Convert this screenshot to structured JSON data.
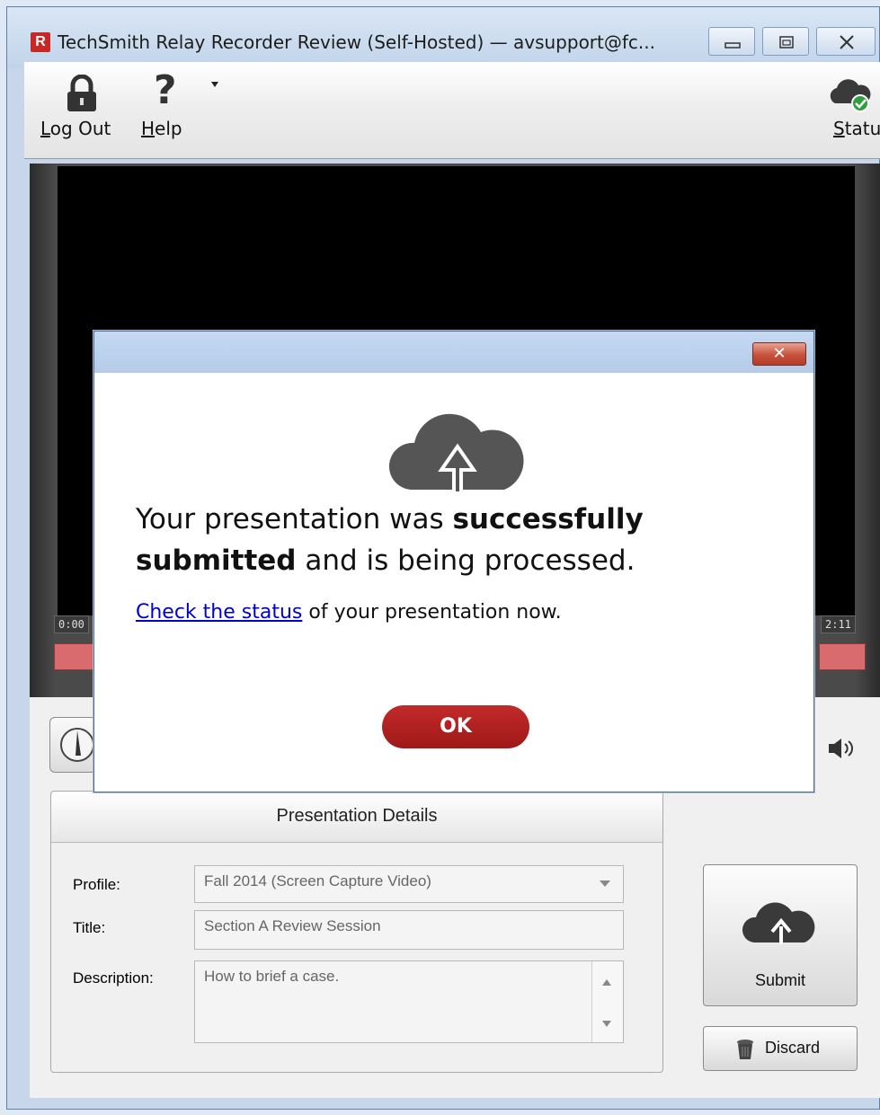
{
  "window": {
    "title": "TechSmith Relay Recorder Review (Self-Hosted) — avsupport@fc...",
    "app_icon_letter": "R"
  },
  "toolbar": {
    "logout_label_underlined": "L",
    "logout_label_rest": "og Out",
    "help_label_underlined": "H",
    "help_label_rest": "elp",
    "help_glyph": "?",
    "status_label_underlined": "S",
    "status_label_rest": "tatus"
  },
  "player": {
    "time_start": "0:00",
    "time_end": "2:11"
  },
  "dialog": {
    "message_part1": "Your presentation was ",
    "message_bold": "successfully submitted",
    "message_part2": " and is being processed.",
    "link_text": "Check the status",
    "link_rest": " of your presentation now.",
    "ok_label": "OK",
    "close_glyph": "✕"
  },
  "details": {
    "title": "Presentation Details",
    "profile_label": "Profile:",
    "profile_value": "Fall 2014 (Screen Capture Video)",
    "title_label": "Title:",
    "title_value": "Section A Review Session",
    "description_label": "Description:",
    "description_value": "How to brief a case."
  },
  "actions": {
    "submit_label": "Submit",
    "discard_label": "Discard"
  },
  "colors": {
    "accent_red": "#b01e1e",
    "link_blue": "#0000cc",
    "status_green": "#2e9e3e"
  },
  "icons": [
    "lock-icon",
    "help-icon",
    "cloud-status-icon",
    "cloud-upload-icon",
    "trash-icon",
    "speaker-icon"
  ]
}
